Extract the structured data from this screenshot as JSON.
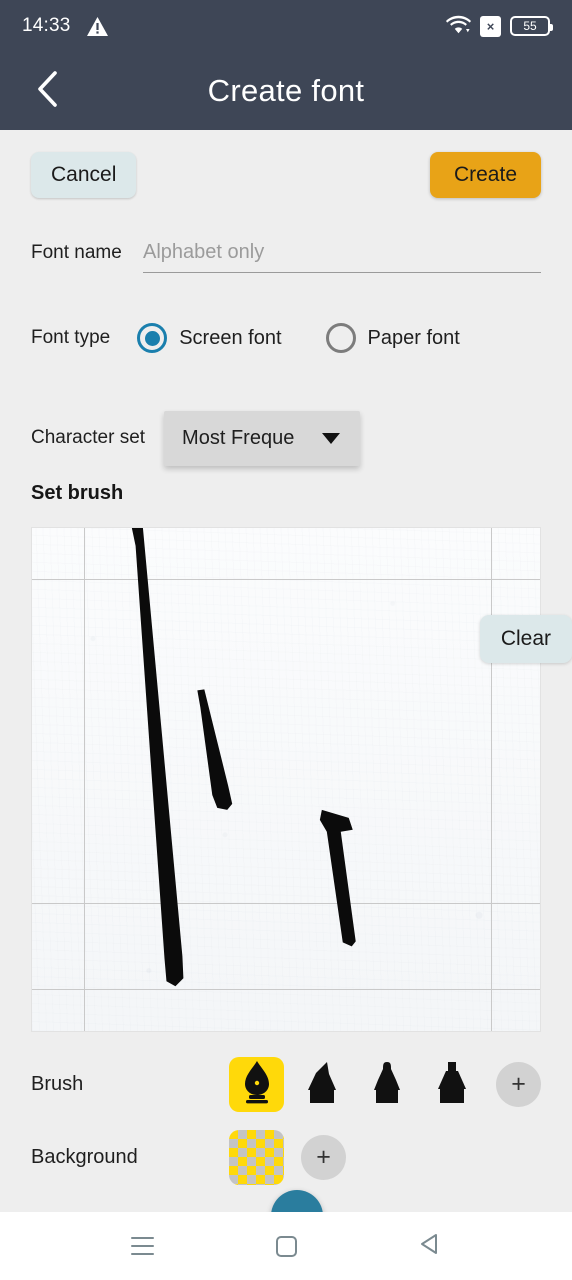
{
  "status_bar": {
    "clock": "14:33",
    "warning_icon": "warning-triangle-icon",
    "wifi_icon": "wifi-icon",
    "x_badge": "×",
    "battery_level": "55"
  },
  "title_bar": {
    "back_icon": "chevron-left-icon",
    "title": "Create font"
  },
  "actions": {
    "cancel_label": "Cancel",
    "create_label": "Create"
  },
  "form": {
    "font_name": {
      "label": "Font name",
      "value": "",
      "placeholder": "Alphabet only"
    },
    "font_type": {
      "label": "Font type",
      "options": [
        {
          "label": "Screen font",
          "selected": true
        },
        {
          "label": "Paper font",
          "selected": false
        }
      ]
    },
    "character_set": {
      "label": "Character set",
      "value": "Most Freque",
      "caret_icon": "caret-down-icon"
    }
  },
  "set_brush": {
    "heading": "Set brush",
    "clear_label": "Clear",
    "canvas": {
      "grid": {
        "vertical_lines": [
          52,
          459
        ],
        "horizontal_lines": [
          51,
          375,
          461
        ]
      },
      "strokes": [
        {
          "name": "stroke-long-left"
        },
        {
          "name": "stroke-short-middle"
        },
        {
          "name": "stroke-hooked-right"
        }
      ]
    }
  },
  "brush": {
    "label": "Brush",
    "items": [
      {
        "icon": "fountain-pen-nib-icon",
        "selected": true
      },
      {
        "icon": "chisel-marker-icon",
        "selected": false
      },
      {
        "icon": "bullet-marker-icon",
        "selected": false
      },
      {
        "icon": "flat-marker-icon",
        "selected": false
      }
    ],
    "add_label": "+"
  },
  "background": {
    "label": "Background",
    "items": [
      {
        "icon": "checkerboard-transparent-swatch",
        "selected": false
      }
    ],
    "add_label": "+"
  },
  "nav_bar": {
    "recents_icon": "hamburger-icon",
    "home_icon": "square-icon",
    "back_icon": "triangle-left-icon"
  },
  "colors": {
    "header": "#3e4656",
    "accent_orange": "#e8a317",
    "accent_blue": "#1a7fad",
    "brush_yellow": "#ffd90a",
    "button_soft_blue": "#dce8ea",
    "page_bg": "#eeeeee"
  }
}
